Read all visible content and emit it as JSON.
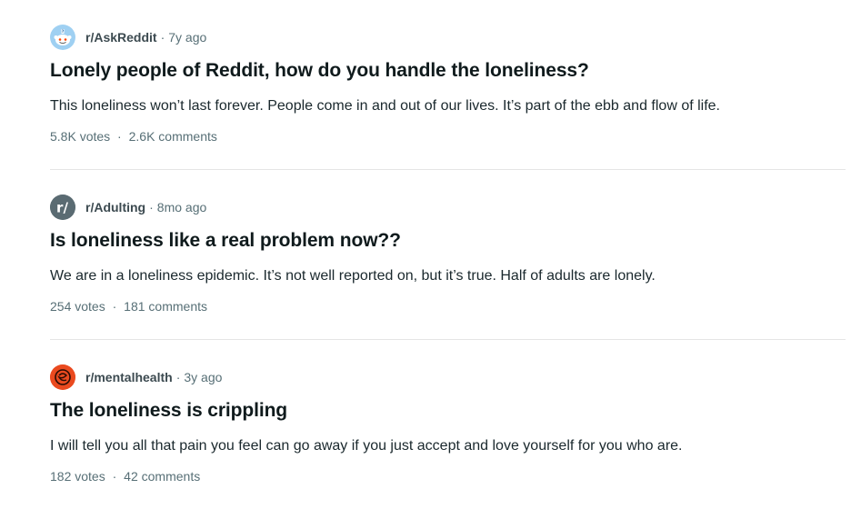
{
  "posts": [
    {
      "subreddit": "r/AskReddit",
      "time": "7y ago",
      "title": "Lonely people of Reddit, how do you handle the loneliness?",
      "snippet": "This loneliness won’t last forever. People come in and out of our lives. It’s part of the ebb and flow of life.",
      "votes": "5.8K votes",
      "comments": "2.6K comments",
      "icon": "askreddit-snoo-icon",
      "icon_color": "#6fb3e8"
    },
    {
      "subreddit": "r/Adulting",
      "time": "8mo ago",
      "title": "Is loneliness like a real problem now??",
      "snippet": "We are in a loneliness epidemic. It’s not well reported on, but it’s true. Half of adults are lonely.",
      "votes": "254 votes",
      "comments": "181 comments",
      "icon": "subreddit-r-icon",
      "icon_color": "#5a6b72"
    },
    {
      "subreddit": "r/mentalhealth",
      "time": "3y ago",
      "title": "The loneliness is crippling",
      "snippet": "I will tell you all that pain you feel can go away if you just accept and love yourself for you who are.",
      "votes": "182 votes",
      "comments": "42 comments",
      "icon": "mentalhealth-brain-icon",
      "icon_color": "#ea4a1f"
    }
  ],
  "separator": "·"
}
